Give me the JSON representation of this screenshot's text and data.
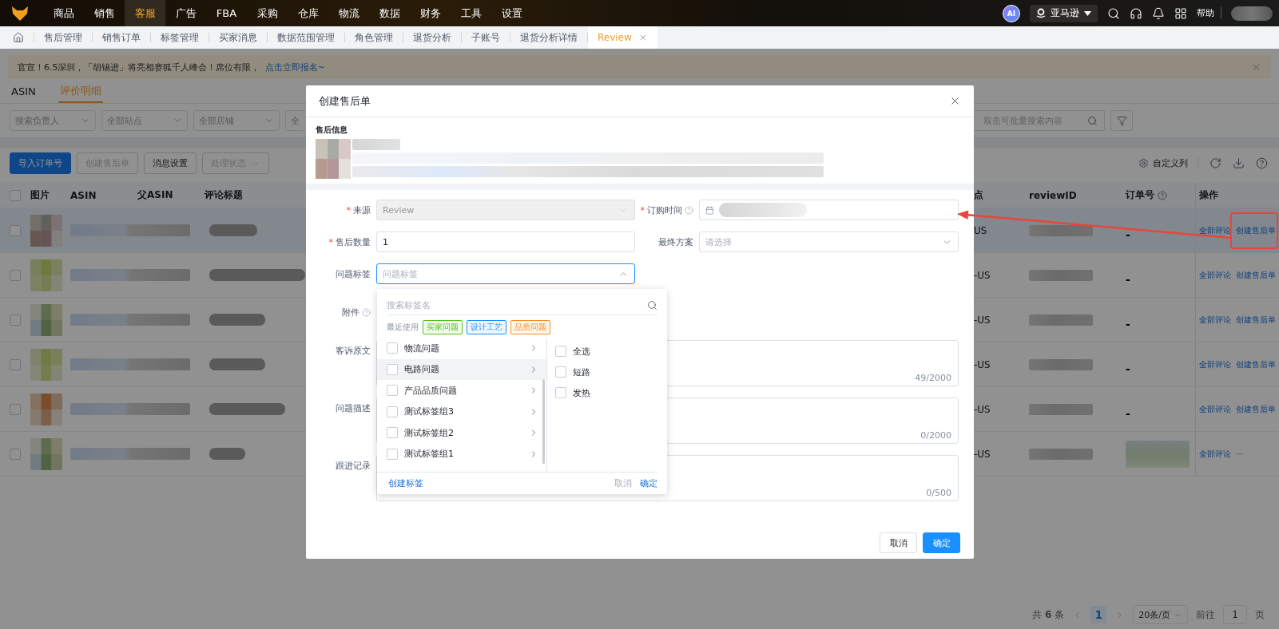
{
  "top_nav": {
    "items": [
      {
        "label": "商品",
        "selected": false
      },
      {
        "label": "销售",
        "selected": false
      },
      {
        "label": "客服",
        "selected": true
      },
      {
        "label": "广告",
        "selected": false
      },
      {
        "label": "FBA",
        "selected": false
      },
      {
        "label": "采购",
        "selected": false
      },
      {
        "label": "仓库",
        "selected": false
      },
      {
        "label": "物流",
        "selected": false
      },
      {
        "label": "数据",
        "selected": false
      },
      {
        "label": "财务",
        "selected": false
      },
      {
        "label": "工具",
        "selected": false
      },
      {
        "label": "设置",
        "selected": false
      }
    ],
    "ai_badge": "AI",
    "store_selector": "亚马逊",
    "help": "帮助"
  },
  "tabs": [
    {
      "label": "售后管理",
      "selected": false,
      "closable": false
    },
    {
      "label": "销售订单",
      "selected": false,
      "closable": false
    },
    {
      "label": "标签管理",
      "selected": false,
      "closable": false
    },
    {
      "label": "买家消息",
      "selected": false,
      "closable": false
    },
    {
      "label": "数据范围管理",
      "selected": false,
      "closable": false
    },
    {
      "label": "角色管理",
      "selected": false,
      "closable": false
    },
    {
      "label": "退货分析",
      "selected": false,
      "closable": false
    },
    {
      "label": "子账号",
      "selected": false,
      "closable": false
    },
    {
      "label": "退货分析详情",
      "selected": false,
      "closable": false
    },
    {
      "label": "Review",
      "selected": true,
      "closable": true
    }
  ],
  "notice": {
    "text": "官宣！6.5深圳，「胡锡进」将亮相赛狐千人峰会！席位有限，",
    "link": "点击立即报名~"
  },
  "sub_tabs": [
    {
      "label": "ASIN",
      "selected": false
    },
    {
      "label": "评价明细",
      "selected": true
    }
  ],
  "filters": [
    {
      "placeholder": "搜索负责人",
      "clipped": false
    },
    {
      "placeholder": "全部站点",
      "clipped": false
    },
    {
      "placeholder": "全部店铺",
      "clipped": false
    },
    {
      "placeholder": "全",
      "clipped": true
    }
  ],
  "search": {
    "placeholder": "双击可批量搜索内容"
  },
  "toolbar": {
    "buttons": [
      {
        "label": "导入订单号",
        "kind": "primary",
        "disabled": false
      },
      {
        "label": "创建售后单",
        "kind": "default",
        "disabled": true
      },
      {
        "label": "消息设置",
        "kind": "default",
        "disabled": false
      },
      {
        "label": "处理状态",
        "kind": "dropdown",
        "disabled": true
      }
    ],
    "custom_columns": "自定义列"
  },
  "table": {
    "select_all_checked": false,
    "columns_left": [
      {
        "label": "图片",
        "help": false
      },
      {
        "label": "ASIN",
        "help": false
      },
      {
        "label": "父ASIN",
        "help": false
      },
      {
        "label": "评论标题",
        "help": false
      }
    ],
    "columns_right": [
      {
        "label": "点",
        "help": false
      },
      {
        "label": "reviewID",
        "help": false
      },
      {
        "label": "订单号",
        "help": true
      },
      {
        "label": "操作",
        "help": false
      }
    ],
    "rows": [
      {
        "checked": false,
        "highlighted": true,
        "station": "US",
        "order_no": "-",
        "actions": [
          "全部评论",
          "创建售后单"
        ]
      },
      {
        "checked": false,
        "highlighted": false,
        "station": "-US",
        "order_no": "-",
        "actions": [
          "全部评论",
          "创建售后单"
        ]
      },
      {
        "checked": false,
        "highlighted": false,
        "station": "-US",
        "order_no": "-",
        "actions": [
          "全部评论",
          "创建售后单"
        ]
      },
      {
        "checked": false,
        "highlighted": false,
        "station": "-US",
        "order_no": "-",
        "actions": [
          "全部评论",
          "创建售后单"
        ]
      },
      {
        "checked": false,
        "highlighted": false,
        "station": "-US",
        "order_no": "-",
        "actions": [
          "全部评论",
          "创建售后单"
        ]
      },
      {
        "checked": false,
        "highlighted": false,
        "station": "-US",
        "actions": [
          "全部评论"
        ],
        "more": "···"
      }
    ]
  },
  "pagination": {
    "total": "共 **6** 条",
    "pages": [
      {
        "label": "1",
        "selected": true
      }
    ],
    "page_size": "20条/页",
    "goto_label": "前往",
    "goto_value": "1",
    "goto_suffix": "页"
  },
  "dialog": {
    "title": "创建售后单",
    "section_title": "售后信息",
    "fields": [
      {
        "label": "来源",
        "mark": "*",
        "help": false,
        "kind": "select",
        "value": "Review",
        "disabled": true
      },
      {
        "label": "订购时间",
        "mark": "*",
        "help": true,
        "kind": "date"
      },
      {
        "label": "售后数量",
        "mark": "*",
        "help": false,
        "kind": "input",
        "value": "1"
      },
      {
        "label": "最终方案",
        "help": false,
        "kind": "select",
        "placeholder": "请选择",
        "disabled": false
      },
      {
        "label": "问题标签",
        "help": false,
        "kind": "tag_select",
        "placeholder": "问题标签",
        "expanded": true
      },
      {
        "label": "附件",
        "help": true,
        "kind": "upload"
      },
      {
        "label": "客诉原文",
        "help": false,
        "kind": "textarea",
        "counter": "49/2000"
      },
      {
        "label": "问题描述",
        "help": false,
        "kind": "textarea",
        "counter": "0/2000"
      },
      {
        "label": "跟进记录",
        "help": false,
        "kind": "textarea",
        "counter": "0/500"
      }
    ],
    "tag_dropdown": {
      "search_placeholder": "搜索标签名",
      "recent_label": "最近使用",
      "recent_tags": [
        {
          "label": "买家问题",
          "color": "#52c41a"
        },
        {
          "label": "设计工艺",
          "color": "#1890ff"
        },
        {
          "label": "品质问题",
          "color": "#fa8c16"
        }
      ],
      "groups": [
        {
          "label": "物流问题",
          "checked": false,
          "selected": false
        },
        {
          "label": "电路问题",
          "checked": false,
          "selected": true
        },
        {
          "label": "产品品质问题",
          "checked": false,
          "selected": false
        },
        {
          "label": "测试标签组3",
          "checked": false,
          "selected": false
        },
        {
          "label": "测试标签组2",
          "checked": false,
          "selected": false
        },
        {
          "label": "测试标签组1",
          "checked": false,
          "selected": false
        }
      ],
      "options": [
        {
          "label": "全选",
          "checked": false
        },
        {
          "label": "短路",
          "checked": false
        },
        {
          "label": "发热",
          "checked": false
        }
      ],
      "create_link": "创建标签",
      "cancel": "取消",
      "confirm": "确定"
    },
    "buttons": [
      {
        "label": "取消",
        "kind": "default"
      },
      {
        "label": "确定",
        "kind": "primary"
      }
    ]
  }
}
